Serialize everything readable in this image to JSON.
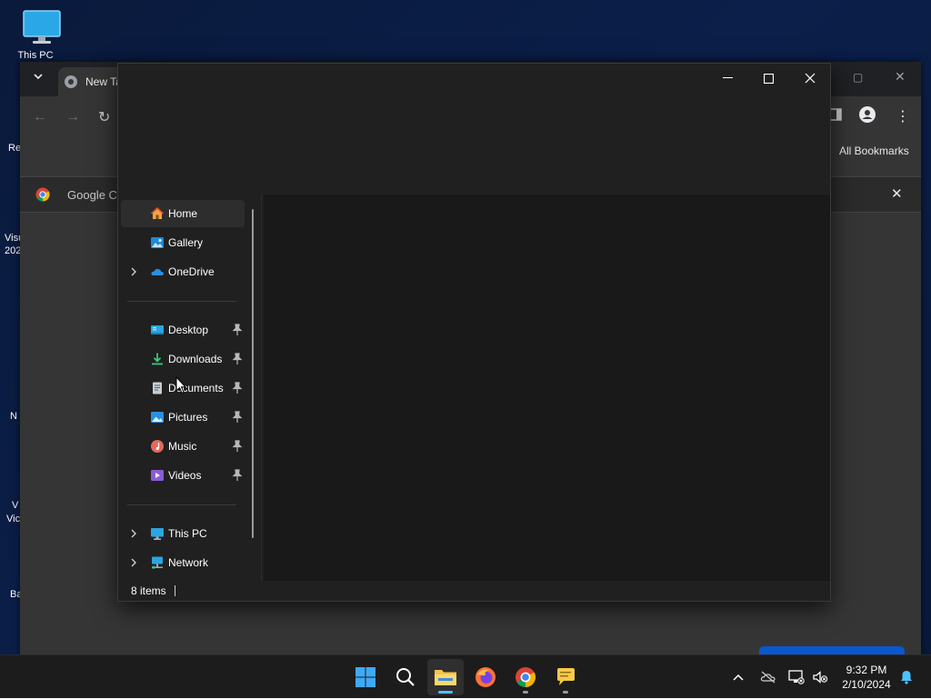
{
  "desktop": {
    "icons": [
      {
        "label": "This PC"
      }
    ],
    "partial_labels": [
      "Re",
      "Visu",
      "202",
      "N",
      "V",
      "Vic",
      "Ba"
    ]
  },
  "chrome": {
    "tab_title": "New Ta",
    "infobar_text": "Google Cl",
    "bookmarks_label": "All Bookmarks"
  },
  "explorer": {
    "nav": {
      "items": [
        {
          "label": "Home",
          "icon": "home-icon",
          "selected": true
        },
        {
          "label": "Gallery",
          "icon": "gallery-icon"
        },
        {
          "label": "OneDrive",
          "icon": "cloud-icon",
          "expandable": true
        },
        {
          "label": "Desktop",
          "icon": "desktop-folder-icon",
          "pinned": true
        },
        {
          "label": "Downloads",
          "icon": "download-icon",
          "pinned": true
        },
        {
          "label": "Documents",
          "icon": "document-icon",
          "pinned": true
        },
        {
          "label": "Pictures",
          "icon": "pictures-icon",
          "pinned": true
        },
        {
          "label": "Music",
          "icon": "music-icon",
          "pinned": true
        },
        {
          "label": "Videos",
          "icon": "videos-icon",
          "pinned": true
        },
        {
          "label": "This PC",
          "icon": "computer-icon",
          "expandable": true
        },
        {
          "label": "Network",
          "icon": "network-icon",
          "expandable": true
        }
      ]
    },
    "status": {
      "items_count": "8 items"
    }
  },
  "taskbar": {
    "clock": {
      "time": "9:32 PM",
      "date": "2/10/2024"
    }
  },
  "colors": {
    "accent": "#4cc2ff",
    "explorer_bg": "#202020",
    "taskbar_bg": "#1c1c1c"
  }
}
